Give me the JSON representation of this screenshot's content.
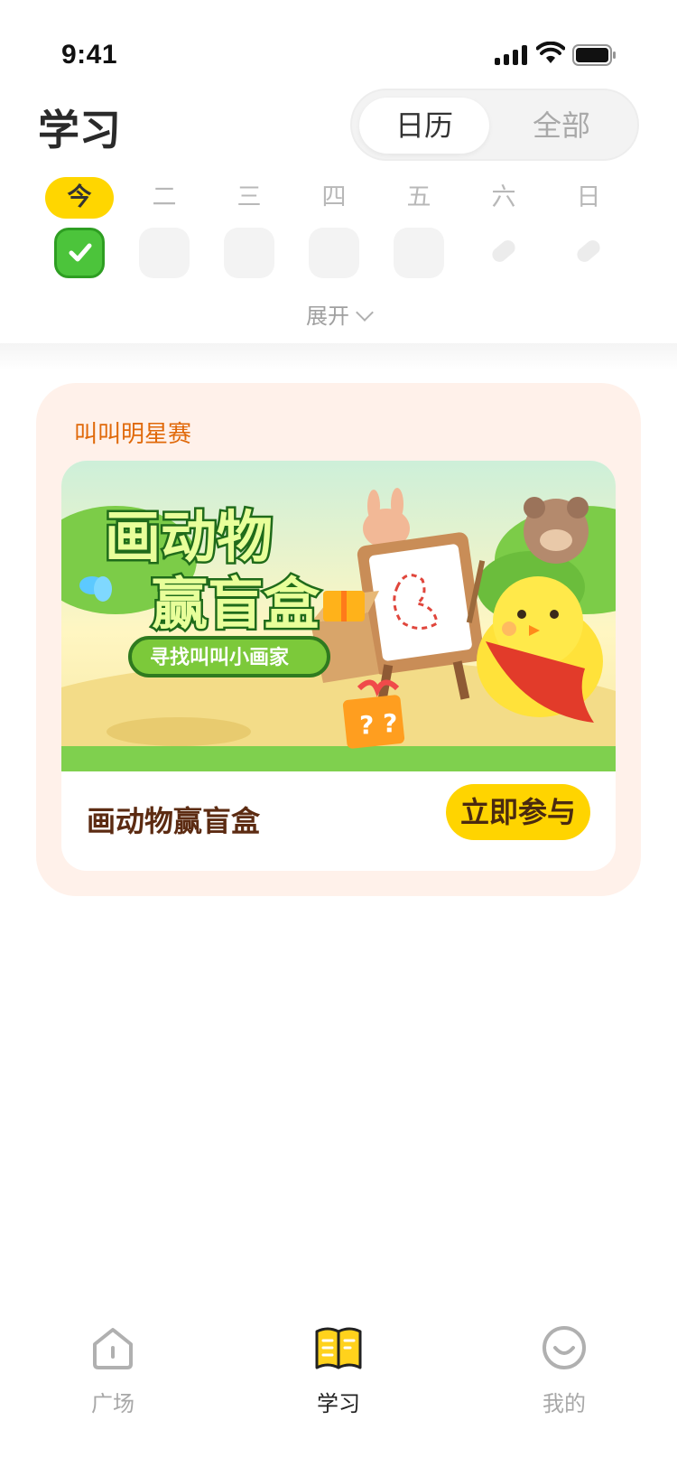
{
  "status_bar": {
    "time": "9:41"
  },
  "header": {
    "title": "学习",
    "segments": [
      {
        "label": "日历",
        "active": true
      },
      {
        "label": "全部",
        "active": false
      }
    ]
  },
  "week": {
    "days": [
      {
        "label": "今",
        "state": "done"
      },
      {
        "label": "二",
        "state": "empty"
      },
      {
        "label": "三",
        "state": "empty"
      },
      {
        "label": "四",
        "state": "empty"
      },
      {
        "label": "五",
        "state": "empty"
      },
      {
        "label": "六",
        "state": "rest"
      },
      {
        "label": "日",
        "state": "rest"
      }
    ],
    "expand_label": "展开"
  },
  "contest": {
    "section_title": "叫叫明星赛",
    "banner": {
      "title_line1": "画动物",
      "title_line2": "赢盲盒",
      "subtitle": "寻找叫叫小画家",
      "box_mark": "?"
    },
    "activity_name": "画动物赢盲盒",
    "join_label": "立即参与"
  },
  "tabbar": {
    "items": [
      {
        "label": "广场",
        "icon": "house-icon",
        "active": false
      },
      {
        "label": "学习",
        "icon": "book-icon",
        "active": true
      },
      {
        "label": "我的",
        "icon": "smile-face-icon",
        "active": false
      }
    ]
  },
  "colors": {
    "accent": "#ffd600",
    "done_green": "#4cc43b",
    "contest_bg": "#fff1ea",
    "contest_title": "#e0690a"
  }
}
